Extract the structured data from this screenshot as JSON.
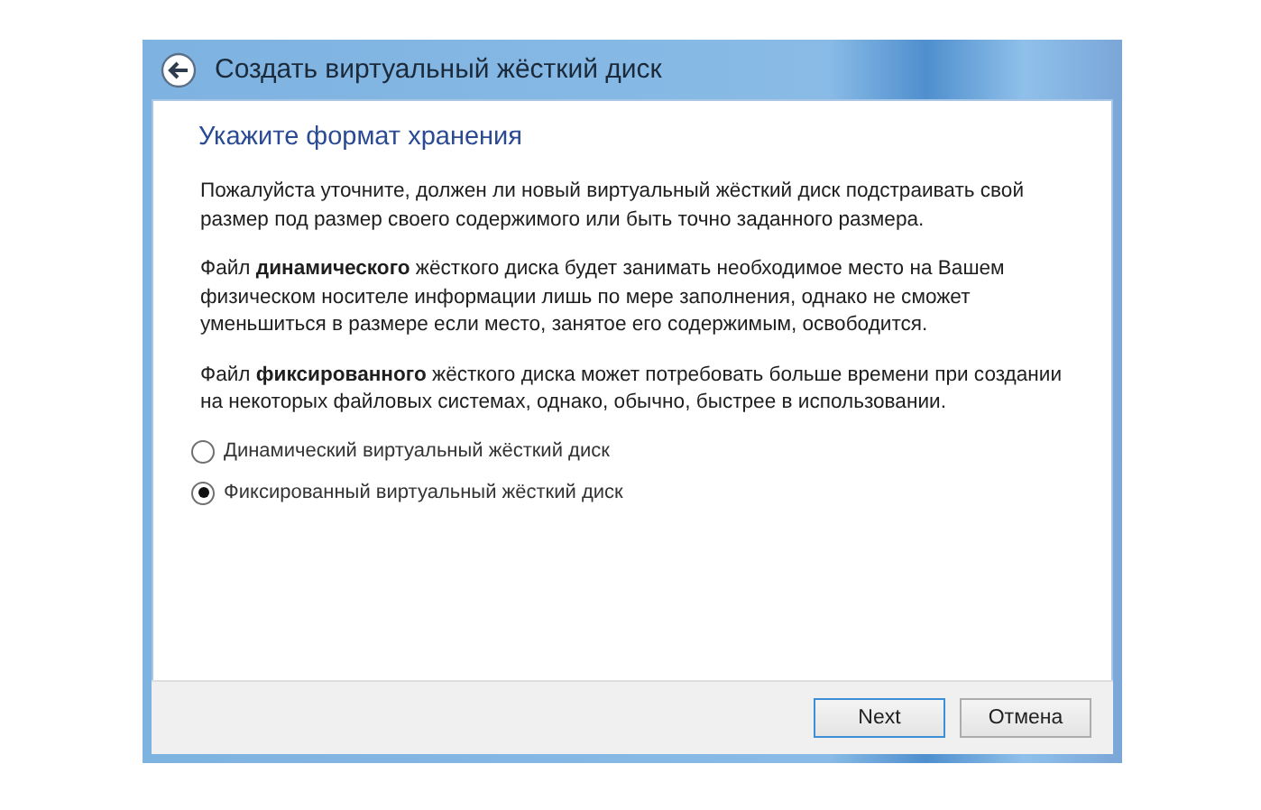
{
  "window": {
    "title": "Создать виртуальный жёсткий диск"
  },
  "heading": "Укажите формат хранения",
  "paragraphs": [
    "Пожалуйста уточните, должен ли новый виртуальный жёсткий диск подстраивать свой размер под размер своего содержимого или быть точно заданного размера.",
    "Файл **динамического** жёсткого диска будет занимать необходимое место на Вашем физическом носителе информации лишь по мере заполнения, однако не сможет уменьшиться в размере если место, занятое его содержимым, освободится.",
    "Файл **фиксированного** жёсткого диска может потребовать больше времени при создании на некоторых файловых системах, однако, обычно, быстрее в использовании."
  ],
  "options": [
    {
      "label": "Динамический виртуальный жёсткий диск",
      "selected": false
    },
    {
      "label": "Фиксированный виртуальный жёсткий диск",
      "selected": true
    }
  ],
  "buttons": [
    {
      "label": "Next",
      "default": true
    },
    {
      "label": "Отмена",
      "default": false
    }
  ]
}
